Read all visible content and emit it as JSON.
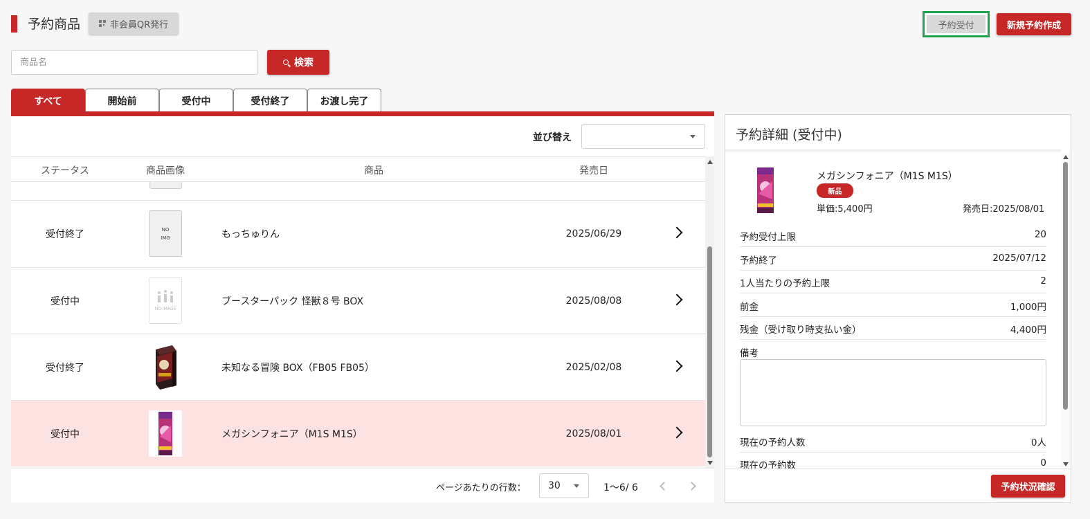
{
  "header": {
    "title": "予約商品",
    "qr_button": "非会員QR発行",
    "accept_button": "予約受付",
    "new_button": "新規予約作成"
  },
  "search": {
    "placeholder": "商品名",
    "value": "",
    "button": "検索"
  },
  "tabs": [
    {
      "label": "すべて",
      "active": true
    },
    {
      "label": "開始前",
      "active": false
    },
    {
      "label": "受付中",
      "active": false
    },
    {
      "label": "受付終了",
      "active": false
    },
    {
      "label": "お渡し完了",
      "active": false
    }
  ],
  "sort": {
    "label": "並び替え",
    "value": ""
  },
  "table": {
    "columns": [
      "ステータス",
      "商品画像",
      "商品",
      "発売日"
    ],
    "rows": [
      {
        "status": "受付終了",
        "image": "no-img",
        "image_text": [
          "NO",
          "IMG"
        ],
        "name": "もっちゅりん",
        "date": "2025/06/29",
        "selected": false
      },
      {
        "status": "受付中",
        "image": "no-image",
        "image_text": [
          "NO IMAGE"
        ],
        "name": "ブースターパック 怪獣８号 BOX",
        "date": "2025/08/08",
        "selected": false
      },
      {
        "status": "受付終了",
        "image": "product-box",
        "name": "未知なる冒険 BOX（FB05 FB05）",
        "date": "2025/02/08",
        "selected": false
      },
      {
        "status": "受付中",
        "image": "product-pack",
        "name": "メガシンフォニア（M1S M1S）",
        "date": "2025/08/01",
        "selected": true
      }
    ]
  },
  "pagination": {
    "rows_per_page_label": "ページあたりの行数：",
    "rows_per_page": "30",
    "range": "1〜6/ 6"
  },
  "detail": {
    "title": "予約詳細 (受付中)",
    "product_name": "メガシンフォニア（M1S M1S）",
    "badge": "新品",
    "unit_price": "単価:5,400円",
    "release_date": "発売日:2025/08/01",
    "fields": [
      {
        "label": "予約受付上限",
        "value": "20"
      },
      {
        "label": "予約終了",
        "value": "2025/07/12"
      },
      {
        "label": "1人当たりの予約上限",
        "value": "2"
      },
      {
        "label": "前金",
        "value": "1,000円"
      },
      {
        "label": "残金（受け取り時支払い金）",
        "value": "4,400円"
      }
    ],
    "memo_label": "備考",
    "memo_value": "",
    "counts": [
      {
        "label": "現在の予約人数",
        "value": "0人"
      },
      {
        "label": "現在の予約数",
        "value": "0"
      }
    ],
    "status_button": "予約状況確認"
  },
  "colors": {
    "primary": "#c62828",
    "selected_row": "#fde2e2",
    "highlight_border": "#1fa34a"
  }
}
